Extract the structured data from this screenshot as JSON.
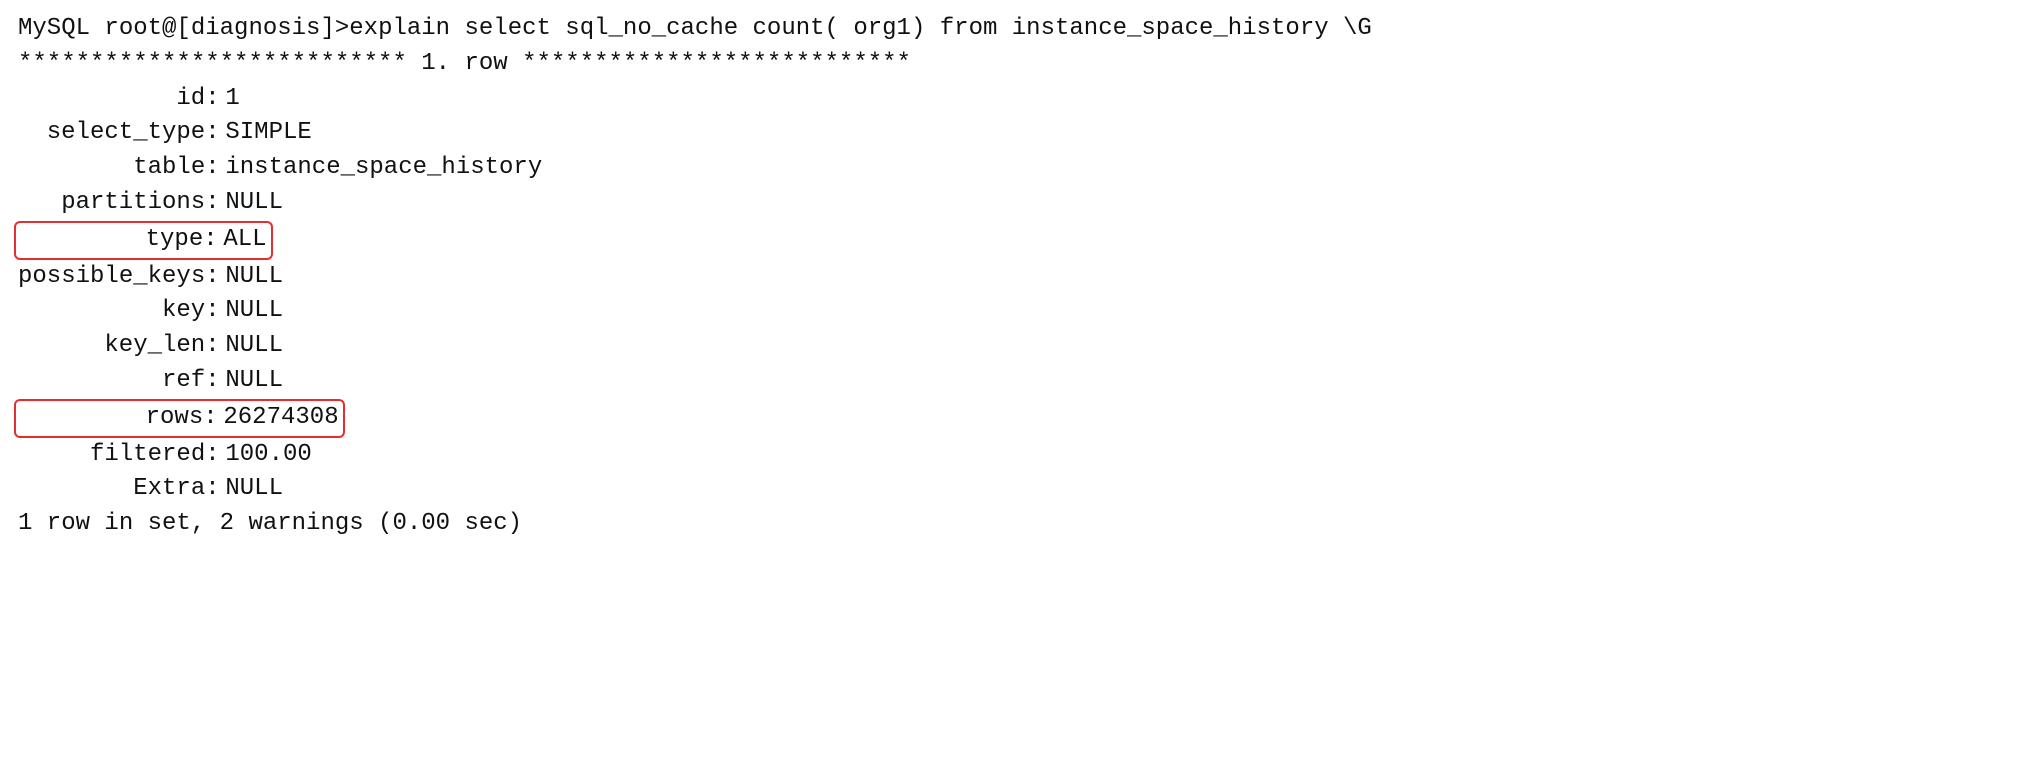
{
  "prompt": "MySQL root@[diagnosis]>",
  "command": "explain  select  sql_no_cache count( org1)  from instance_space_history \\G",
  "row_header": "*************************** 1. row ***************************",
  "fields": {
    "id": {
      "label": "id",
      "value": "1"
    },
    "select_type": {
      "label": "select_type",
      "value": "SIMPLE"
    },
    "table": {
      "label": "table",
      "value": "instance_space_history"
    },
    "partitions": {
      "label": "partitions",
      "value": "NULL"
    },
    "type": {
      "label": "type",
      "value": "ALL"
    },
    "possible_keys": {
      "label": "possible_keys",
      "value": "NULL"
    },
    "key": {
      "label": "key",
      "value": "NULL"
    },
    "key_len": {
      "label": "key_len",
      "value": "NULL"
    },
    "ref": {
      "label": "ref",
      "value": "NULL"
    },
    "rows": {
      "label": "rows",
      "value": "26274308"
    },
    "filtered": {
      "label": "filtered",
      "value": "100.00"
    },
    "Extra": {
      "label": "Extra",
      "value": "NULL"
    }
  },
  "footer": "1 row in set, 2 warnings (0.00 sec)"
}
